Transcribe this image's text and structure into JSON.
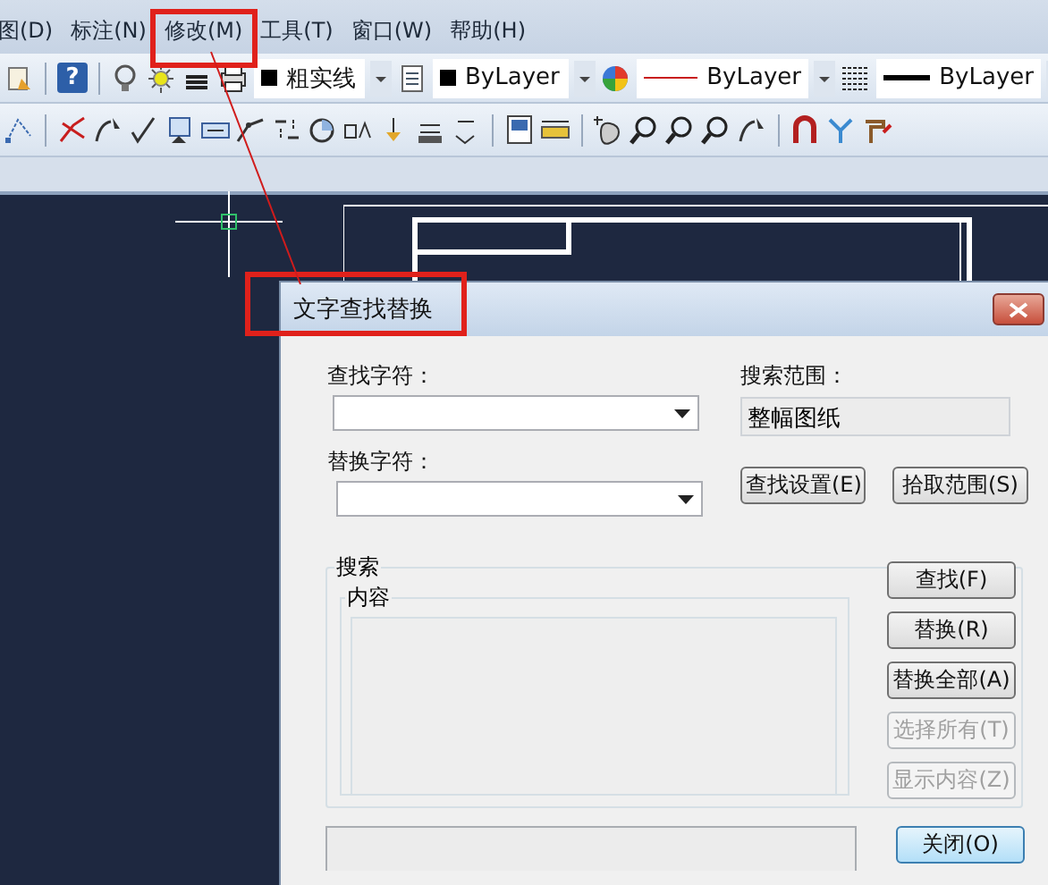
{
  "menu": [
    {
      "label": "图(D)"
    },
    {
      "label": "标注(N)"
    },
    {
      "label": "修改(M)"
    },
    {
      "label": "工具(T)"
    },
    {
      "label": "窗口(W)"
    },
    {
      "label": "帮助(H)"
    }
  ],
  "toolbar": {
    "help": "?",
    "layer": "粗实线",
    "color_setting": "ByLayer",
    "linetype": "ByLayer",
    "lineweight": "ByLayer"
  },
  "dialog": {
    "title": "文字查找替换",
    "find_label": "查找字符：",
    "replace_label": "替换字符：",
    "scope_label": "搜索范围：",
    "scope_value": "整幅图纸",
    "find_settings": "查找设置(E)",
    "pick_range": "拾取范围(S)",
    "search_group": "搜索",
    "content_group": "内容",
    "side_buttons": [
      {
        "label": "查找(F)",
        "disabled": false
      },
      {
        "label": "替换(R)",
        "disabled": false
      },
      {
        "label": "替换全部(A)",
        "disabled": false
      },
      {
        "label": "选择所有(T)",
        "disabled": true
      },
      {
        "label": "显示内容(Z)",
        "disabled": true
      }
    ],
    "close": {
      "label": "关闭(O)",
      "default": true
    }
  }
}
